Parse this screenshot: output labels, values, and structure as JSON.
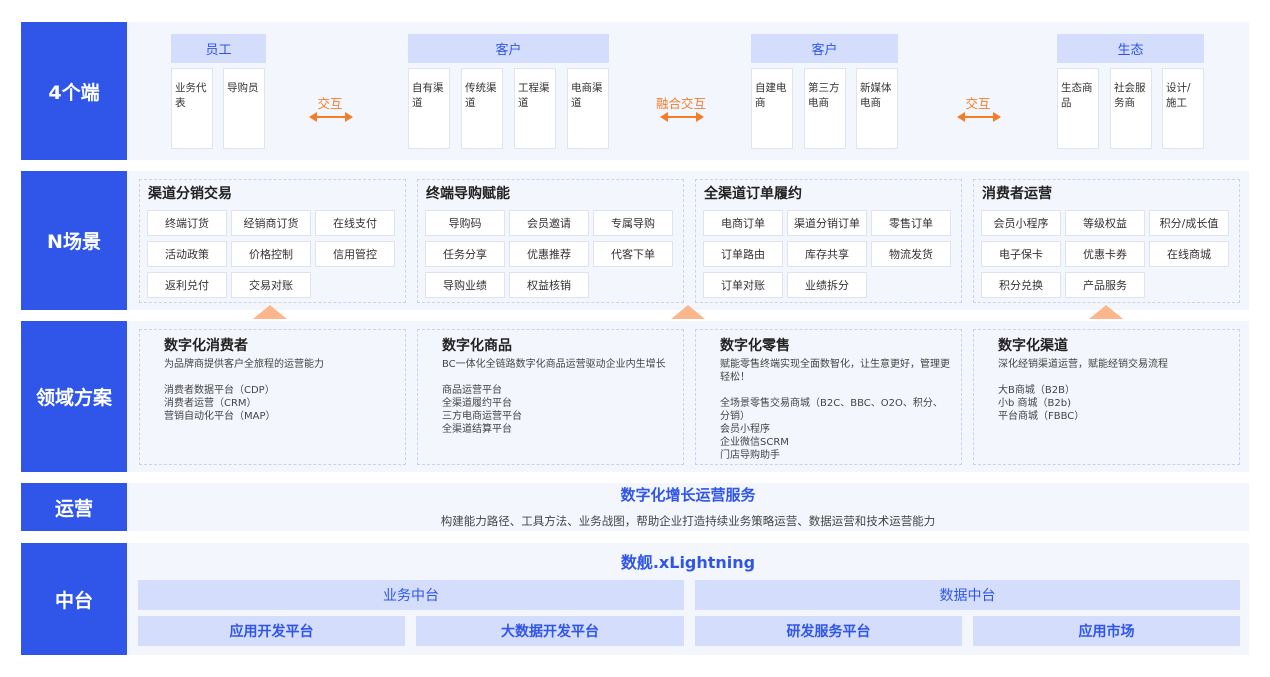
{
  "rows": {
    "r1": "4个端",
    "r2": "N场景",
    "r3": "领域方案",
    "r4": "运营",
    "r5": "中台"
  },
  "ends": {
    "groups": [
      "员工",
      "客户",
      "客户",
      "生态"
    ],
    "g1_items": [
      "业务代表",
      "导购员"
    ],
    "g2_items": [
      "自有渠道",
      "传统渠道",
      "工程渠道",
      "电商渠道"
    ],
    "g3_items": [
      "自建电商",
      "第三方电商",
      "新媒体电商"
    ],
    "g4_items": [
      "生态商品",
      "社会服务商",
      "设计/施工"
    ],
    "interact1": "交互",
    "interact2": "融合交互",
    "interact3": "交互"
  },
  "scenes": [
    {
      "title": "渠道分销交易",
      "items": [
        "终端订货",
        "经销商订货",
        "在线支付",
        "活动政策",
        "价格控制",
        "信用管控",
        "返利兑付",
        "交易对账"
      ]
    },
    {
      "title": "终端导购赋能",
      "items": [
        "导购码",
        "会员邀请",
        "专属导购",
        "任务分享",
        "优惠推荐",
        "代客下单",
        "导购业绩",
        "权益核销"
      ]
    },
    {
      "title": "全渠道订单履约",
      "items": [
        "电商订单",
        "渠道分销订单",
        "零售订单",
        "订单路由",
        "库存共享",
        "物流发货",
        "订单对账",
        "业绩拆分"
      ]
    },
    {
      "title": "消费者运营",
      "items": [
        "会员小程序",
        "等级权益",
        "积分/成长值",
        "电子保卡",
        "优惠卡券",
        "在线商城",
        "积分兑换",
        "产品服务"
      ]
    }
  ],
  "domains": [
    {
      "title": "数字化消费者",
      "sub": "为品牌商提供客户全旅程的运营能力",
      "items": [
        "消费者数据平台（CDP）",
        "消费者运营（CRM）",
        "营销自动化平台（MAP）"
      ]
    },
    {
      "title": "数字化商品",
      "sub": "BC一体化全链路数字化商品运营驱动企业内生增长",
      "items": [
        "商品运营平台",
        "全渠道履约平台",
        "三方电商运营平台",
        "全渠道结算平台"
      ]
    },
    {
      "title": "数字化零售",
      "sub": "赋能零售终端实现全面数智化，让生意更好，管理更轻松！",
      "items": [
        "全场景零售交易商城（B2C、BBC、O2O、积分、分销）",
        "会员小程序",
        "企业微信SCRM",
        "门店导购助手"
      ]
    },
    {
      "title": "数字化渠道",
      "sub": "深化经销渠道运营，赋能经销交易流程",
      "items": [
        "大B商城（B2B）",
        "小b 商城（B2b)",
        "平台商城（FBBC）"
      ]
    }
  ],
  "ops": {
    "title": "数字化增长运营服务",
    "desc": "构建能力路径、工具方法、业务战图，帮助企业打造持续业务策略运营、数据运营和技术运营能力"
  },
  "platform": {
    "title": "数舰.xLightning",
    "biz": "业务中台",
    "data": "数据中台",
    "subs": [
      "应用开发平台",
      "大数据开发平台",
      "研发服务平台",
      "应用市场"
    ]
  },
  "colors": {
    "primary": "#2f56e8",
    "accent": "#f47d2b",
    "light": "#d4ddfc"
  }
}
